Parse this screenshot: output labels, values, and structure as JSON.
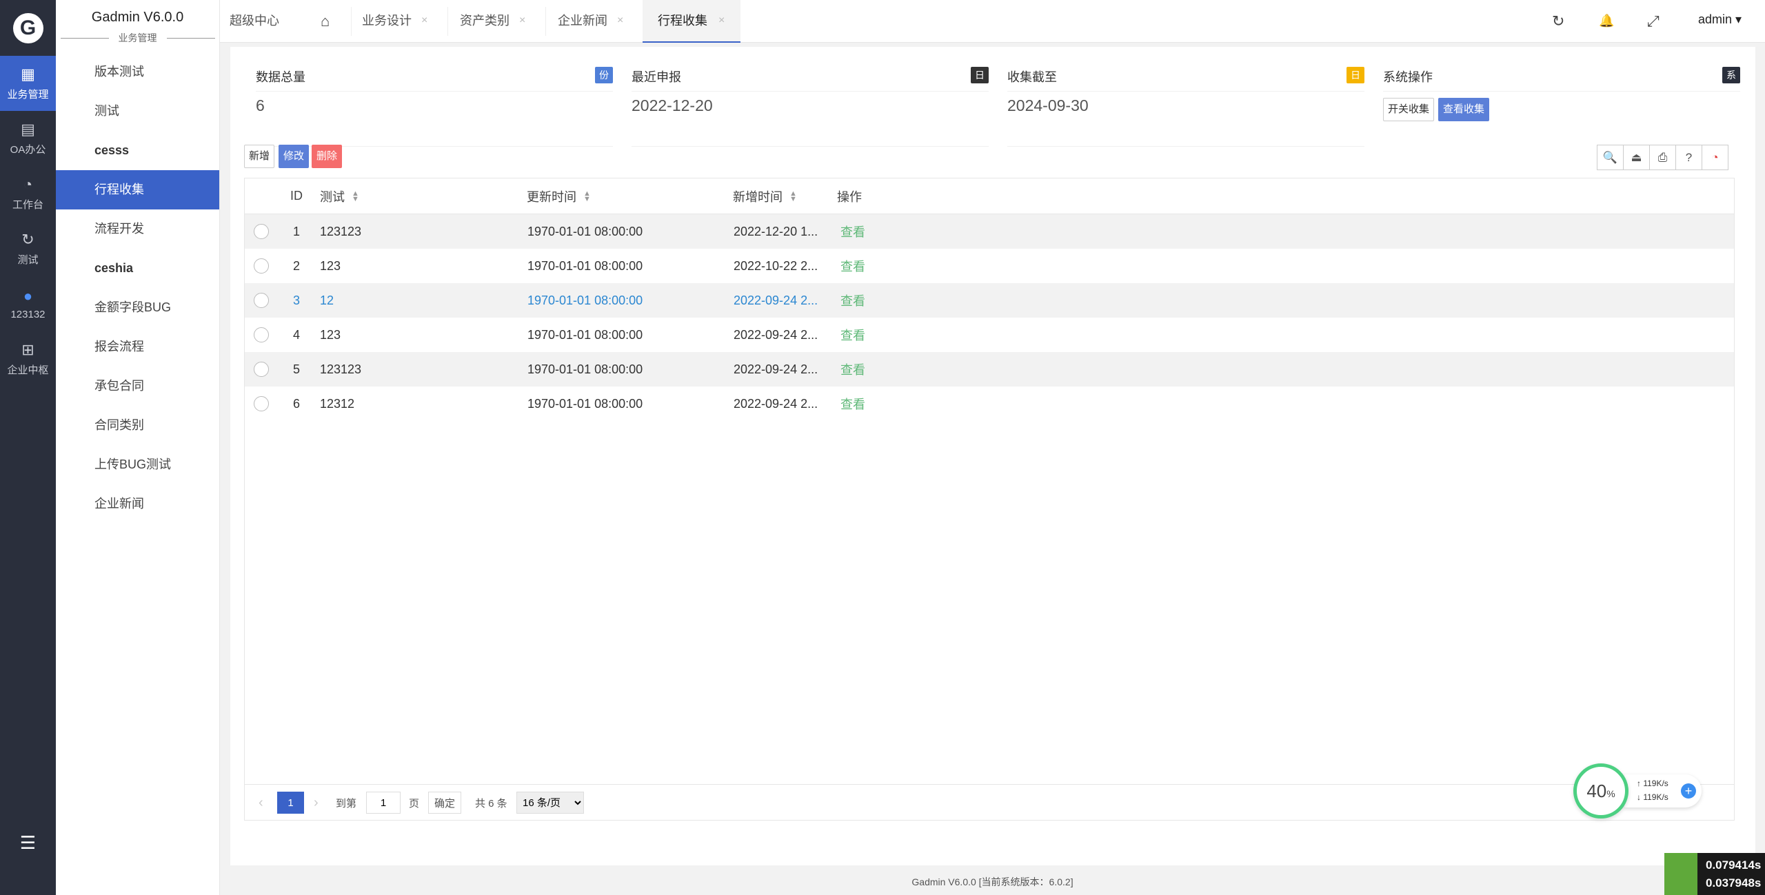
{
  "rail": {
    "logo": "G",
    "items": [
      {
        "icon": "▦",
        "label": "业务管理"
      },
      {
        "icon": "▤",
        "label": "OA办公"
      },
      {
        "icon": "◔",
        "label": "工作台"
      },
      {
        "icon": "↻",
        "label": "测试"
      },
      {
        "icon": "●",
        "label": "123132"
      },
      {
        "icon": "⊞",
        "label": "企业中枢"
      }
    ],
    "collapse_icon": "☰"
  },
  "sidebar": {
    "title": "Gadmin V6.0.0",
    "subtitle": "业务管理",
    "items": [
      {
        "label": "版本测试"
      },
      {
        "label": "测试"
      },
      {
        "label": "cesss"
      },
      {
        "label": "行程收集"
      },
      {
        "label": "流程开发"
      },
      {
        "label": "ceshia"
      },
      {
        "label": "金额字段BUG"
      },
      {
        "label": "报会流程"
      },
      {
        "label": "承包合同"
      },
      {
        "label": "合同类别"
      },
      {
        "label": "上传BUG测试"
      },
      {
        "label": "企业新闻"
      }
    ]
  },
  "topbar": {
    "tabs": [
      {
        "label": "超级中心"
      },
      {
        "label": "业务设计"
      },
      {
        "label": "资产类别"
      },
      {
        "label": "企业新闻"
      },
      {
        "label": "行程收集"
      }
    ],
    "close_glyph": "×",
    "home_icon": "⌂",
    "refresh_icon": "↻",
    "bell_icon": "🔔",
    "fullscreen_icon": "⤢",
    "user": "admin ▾"
  },
  "stats": [
    {
      "title": "数据总量",
      "badge": "份",
      "badge_color": "#4f7fd8",
      "value": "6"
    },
    {
      "title": "最近申报",
      "badge": "日",
      "badge_color": "#333333",
      "value": "2022-12-20"
    },
    {
      "title": "收集截至",
      "badge": "日",
      "badge_color": "#f5b400",
      "value": "2024-09-30"
    },
    {
      "title": "系统操作",
      "badge": "系",
      "badge_color": "#2a2f3c",
      "value": ""
    }
  ],
  "ops": {
    "toggle": "开关收集",
    "view": "查看收集"
  },
  "toolbar": {
    "add": "新增",
    "edit": "修改",
    "delete": "删除",
    "icons": [
      "🔍",
      "⏏",
      "⎙",
      "?",
      "◔"
    ]
  },
  "table": {
    "columns": [
      "ID",
      "测试",
      "更新时间",
      "新增时间",
      "操作"
    ],
    "rows": [
      {
        "id": "1",
        "test": "123123",
        "updated": "1970-01-01 08:00:00",
        "created": "2022-12-20 1...",
        "action": "查看"
      },
      {
        "id": "2",
        "test": "123",
        "updated": "1970-01-01 08:00:00",
        "created": "2022-10-22 2...",
        "action": "查看"
      },
      {
        "id": "3",
        "test": "12",
        "updated": "1970-01-01 08:00:00",
        "created": "2022-09-24 2...",
        "action": "查看"
      },
      {
        "id": "4",
        "test": "123",
        "updated": "1970-01-01 08:00:00",
        "created": "2022-09-24 2...",
        "action": "查看"
      },
      {
        "id": "5",
        "test": "123123",
        "updated": "1970-01-01 08:00:00",
        "created": "2022-09-24 2...",
        "action": "查看"
      },
      {
        "id": "6",
        "test": "12312",
        "updated": "1970-01-01 08:00:00",
        "created": "2022-09-24 2...",
        "action": "查看"
      }
    ]
  },
  "pager": {
    "prev": "‹",
    "page": "1",
    "next": "›",
    "goto": "到第",
    "goto_value": "1",
    "page_unit": "页",
    "confirm": "确定",
    "total": "共 6 条",
    "per_page": "16 条/页"
  },
  "footer": "Gadmin V6.0.0 [当前系统版本：6.0.2]",
  "widgets": {
    "meter_value": "40",
    "meter_unit": "%",
    "up_speed": "↑ 119K/s",
    "down_speed": "↓ 119K/s",
    "plus": "+",
    "timer1": "0.079414s",
    "timer2": "0.037948s"
  },
  "colors": {
    "accent": "#3a62c8",
    "link_green": "#5fb878",
    "highlight_blue": "#2b87d1",
    "delete_red": "#f56c6c"
  }
}
